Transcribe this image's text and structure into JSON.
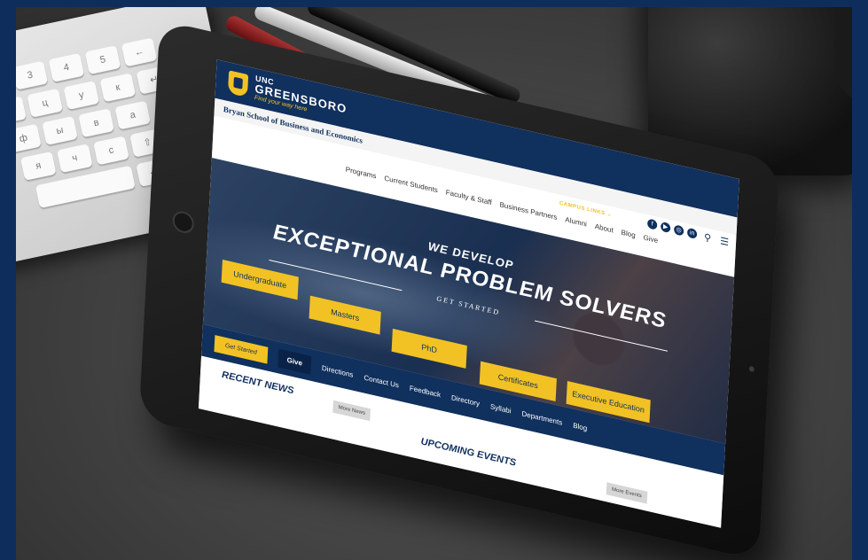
{
  "brand": {
    "line1": "UNC",
    "line2": "GREENSBORO",
    "tagline": "Find your way here",
    "school_name": "Bryan School of Business and Economics"
  },
  "utility": {
    "campus_links": "CAMPUS LINKS ⌄",
    "social_icons": [
      "facebook-icon",
      "youtube-icon",
      "instagram-icon",
      "linkedin-icon"
    ],
    "search_icon": "search-icon",
    "menu_icon": "menu-icon"
  },
  "nav": [
    "Programs",
    "Current Students",
    "Faculty & Staff",
    "Business Partners",
    "Alumni",
    "About",
    "Blog",
    "Give"
  ],
  "hero": {
    "kicker": "WE DEVELOP",
    "headline": "EXCEPTIONAL PROBLEM SOLVERS",
    "get_started": "GET STARTED",
    "programs": [
      "Undergraduate",
      "Masters",
      "PhD",
      "Certificates",
      "Executive Education"
    ]
  },
  "quicklinks": {
    "get_started": "Get Started",
    "give": "Give",
    "links": [
      "Directions",
      "Contact Us",
      "Feedback",
      "Directory",
      "Syllabi",
      "Departments",
      "Blog"
    ]
  },
  "sections": {
    "recent_news": "RECENT NEWS",
    "more_news": "More News",
    "upcoming_events": "UPCOMING EVENTS",
    "more_events": "More Events"
  },
  "colors": {
    "navy": "#10305e",
    "gold": "#f2c224",
    "frame": "#0f2d5c"
  }
}
